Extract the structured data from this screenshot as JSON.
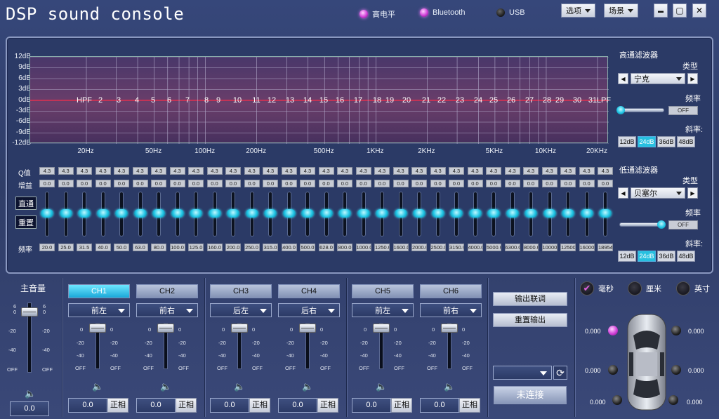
{
  "app": {
    "title": "DSP sound console"
  },
  "indicators": [
    {
      "label": "高电平",
      "state": "on"
    },
    {
      "label": "Bluetooth",
      "state": "on"
    },
    {
      "label": "USB",
      "state": "off"
    }
  ],
  "menu": {
    "options": "选项",
    "scene": "场景"
  },
  "window": {
    "min": "▬",
    "max": "▢",
    "close": "✕"
  },
  "eq": {
    "y_ticks": [
      "12dB",
      "9dB",
      "6dB",
      "3dB",
      "0dB",
      "-3dB",
      "-6dB",
      "-9dB",
      "-12dB"
    ],
    "x_ticks": [
      "20Hz",
      "50Hz",
      "100Hz",
      "200Hz",
      "500Hz",
      "1KHz",
      "2KHz",
      "5KHz",
      "10KHz",
      "20KHz"
    ],
    "band_labels": [
      "HPF",
      "2",
      "3",
      "4",
      "5",
      "6",
      "7",
      "8",
      "9",
      "10",
      "11",
      "12",
      "13",
      "14",
      "15",
      "16",
      "17",
      "18",
      "19",
      "20",
      "21",
      "22",
      "23",
      "24",
      "25",
      "26",
      "27",
      "28",
      "29",
      "30",
      "31",
      "LPF"
    ],
    "q_label": "Q值",
    "gain_label": "增益",
    "freq_label": "频率",
    "q_values": [
      "4.3",
      "4.3",
      "4.3",
      "4.3",
      "4.3",
      "4.3",
      "4.3",
      "4.3",
      "4.3",
      "4.3",
      "4.3",
      "4.3",
      "4.3",
      "4.3",
      "4.3",
      "4.3",
      "4.3",
      "4.3",
      "4.3",
      "4.3",
      "4.3",
      "4.3",
      "4.3",
      "4.3",
      "4.3",
      "4.3",
      "4.3",
      "4.3",
      "4.3",
      "4.3",
      "4.3"
    ],
    "gain_values": [
      "0.0",
      "0.0",
      "0.0",
      "0.0",
      "0.0",
      "0.0",
      "0.0",
      "0.0",
      "0.0",
      "0.0",
      "0.0",
      "0.0",
      "0.0",
      "0.0",
      "0.0",
      "0.0",
      "0.0",
      "0.0",
      "0.0",
      "0.0",
      "0.0",
      "0.0",
      "0.0",
      "0.0",
      "0.0",
      "0.0",
      "0.0",
      "0.0",
      "0.0",
      "0.0",
      "0.0"
    ],
    "freq_values": [
      "20.0",
      "25.0",
      "31.5",
      "40.0",
      "50.0",
      "63.0",
      "80.0",
      "100.0",
      "125.0",
      "160.0",
      "200.0",
      "250.0",
      "315.0",
      "400.0",
      "500.0",
      "628.0",
      "800.0",
      "1000.0",
      "1250.0",
      "1600.0",
      "2000.0",
      "2500.0",
      "3150.0",
      "4000.0",
      "5000.0",
      "6300.0",
      "8000.0",
      "10000",
      "12500",
      "16000",
      "18954"
    ],
    "bypass": "直通",
    "reset": "重置"
  },
  "hpf": {
    "title": "高通滤波器",
    "type_label": "类型",
    "type": "宁克",
    "freq_label": "频率",
    "freq_value": "OFF",
    "slope_label": "斜率:",
    "slopes": [
      "12dB",
      "24dB",
      "36dB",
      "48dB"
    ],
    "active_slope": 1,
    "slider_level": 0
  },
  "lpf": {
    "title": "低通滤波器",
    "type_label": "类型",
    "type": "贝塞尔",
    "freq_label": "频率",
    "freq_value": "OFF",
    "slope_label": "斜率:",
    "slopes": [
      "12dB",
      "24dB",
      "36dB",
      "48dB"
    ],
    "active_slope": 1,
    "slider_level": 1
  },
  "master": {
    "label": "主音量",
    "value": "0.0",
    "scale": [
      "6",
      "0",
      "-20",
      "-40",
      "OFF"
    ]
  },
  "fader_scale": [
    "0",
    "-20",
    "-40",
    "OFF"
  ],
  "channels": [
    {
      "name": "CH1",
      "pos": "前左",
      "value": "0.0",
      "phase": "正相",
      "active": true
    },
    {
      "name": "CH2",
      "pos": "前右",
      "value": "0.0",
      "phase": "正相",
      "active": false
    },
    {
      "name": "CH3",
      "pos": "后左",
      "value": "0.0",
      "phase": "正相",
      "active": false
    },
    {
      "name": "CH4",
      "pos": "后右",
      "value": "0.0",
      "phase": "正相",
      "active": false
    },
    {
      "name": "CH5",
      "pos": "前左",
      "value": "0.0",
      "phase": "正相",
      "active": false
    },
    {
      "name": "CH6",
      "pos": "前右",
      "value": "0.0",
      "phase": "正相",
      "active": false
    }
  ],
  "output": {
    "link": "输出联调",
    "reset": "重置输出",
    "connect": "未连接",
    "port": ""
  },
  "units": [
    {
      "label": "毫秒",
      "checked": true
    },
    {
      "label": "厘米",
      "checked": false
    },
    {
      "label": "英寸",
      "checked": false
    }
  ],
  "delays": {
    "fl": "0.000",
    "fr": "0.000",
    "ml": "0.000",
    "mr": "0.000",
    "rl": "0.000",
    "rr": "0.000"
  },
  "colors": {
    "accent": "#21c6e6",
    "zero_line": "#e03050"
  }
}
